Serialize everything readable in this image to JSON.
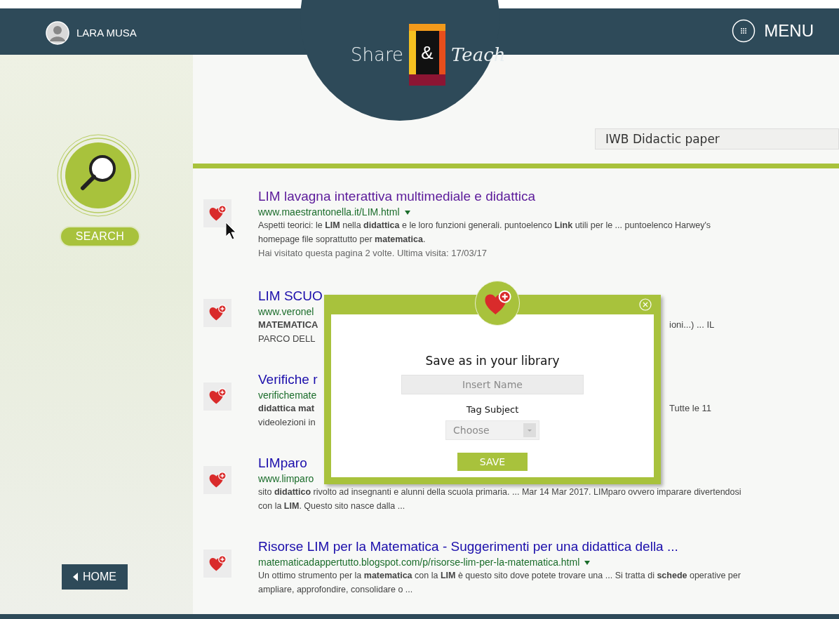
{
  "user": {
    "name": "LARA MUSA"
  },
  "logo": {
    "left": "Share",
    "mark": "&",
    "right": "Teach"
  },
  "menu": {
    "label": "MENU"
  },
  "sidebar": {
    "search_label": "SEARCH",
    "home_label": "HOME"
  },
  "search_field": {
    "value": "IWB Didactic paper"
  },
  "results": [
    {
      "kind": "full",
      "visited": true,
      "title": "LIM lavagna interattiva multimediale e didattica",
      "url": "www.maestrantonella.it/LIM.html",
      "dropdown": true,
      "snippet": "Aspetti teorici: le **LIM** nella **didattica** e le loro funzioni generali. puntoelenco **Link** utili per le ... puntoelenco Harwey's homepage file soprattutto per **matematica**.",
      "note": "Hai visitato questa pagina 2 volte. Ultima visita: 17/03/17"
    },
    {
      "kind": "covered",
      "visited": false,
      "title": "LIM SCUO",
      "url": "www.veronel",
      "lines": [
        {
          "left": "MATEMATICA",
          "right": "ioni...) ... IL"
        },
        {
          "left": "PARCO DELL"
        }
      ]
    },
    {
      "kind": "covered",
      "visited": false,
      "title": "Verifiche r",
      "url": "verifichemate",
      "lines": [
        {
          "left": "didattica mat",
          "right": "Tutte le 11"
        },
        {
          "left": "videolezioni in"
        }
      ]
    },
    {
      "kind": "full",
      "visited": false,
      "title": "LIMparo",
      "url": "www.limparo",
      "dropdown": false,
      "snippet": "sito **didattico** rivolto ad insegnanti e alunni della scuola primaria. ... Mar 14 Mar 2017. LIMparo ovvero imparare divertendosi con la **LIM**. Questo sito nasce dalla ..."
    },
    {
      "kind": "full",
      "visited": false,
      "title": "Risorse LIM per la Matematica - Suggerimenti per una didattica della ...",
      "url": "matematicadappertutto.blogspot.com/p/risorse-lim-per-la-matematica.html",
      "dropdown": true,
      "snippet": "Un ottimo strumento per la **matematica** con la **LIM** è questo sito dove potete trovare una ... Si tratta di **schede** operative per ampliare, approfondire, consolidare o ..."
    }
  ],
  "modal": {
    "title": "Save as in your library",
    "name_placeholder": "Insert Name",
    "tag_label": "Tag Subject",
    "tag_placeholder": "Choose",
    "save_label": "SAVE"
  }
}
